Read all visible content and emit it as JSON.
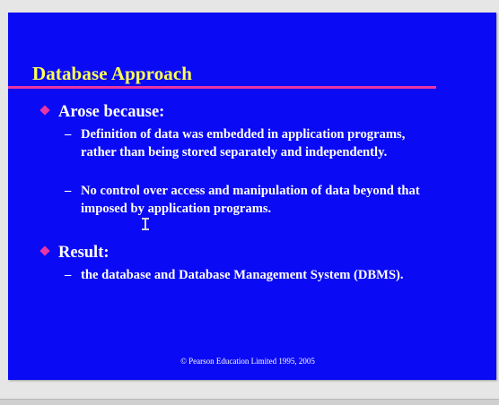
{
  "slide": {
    "title": "Database Approach",
    "bullets": [
      {
        "label": "Arose because:",
        "subitems": [
          "Definition of data was embedded in application programs, rather than being stored separately and independently.",
          "No control over access and manipulation of data beyond that imposed by application programs."
        ]
      },
      {
        "label": "Result:",
        "subitems": [
          "the database and Database Management System (DBMS)."
        ]
      }
    ],
    "dash": "–",
    "footer": "© Pearson Education Limited 1995, 2005"
  },
  "colors": {
    "slide_background": "#0a0af4",
    "title": "#ffff54",
    "accent": "#e836a4",
    "text": "#ffffff"
  },
  "icons": {
    "bullet": "diamond-bullet-icon",
    "cursor": "text-cursor-icon"
  }
}
